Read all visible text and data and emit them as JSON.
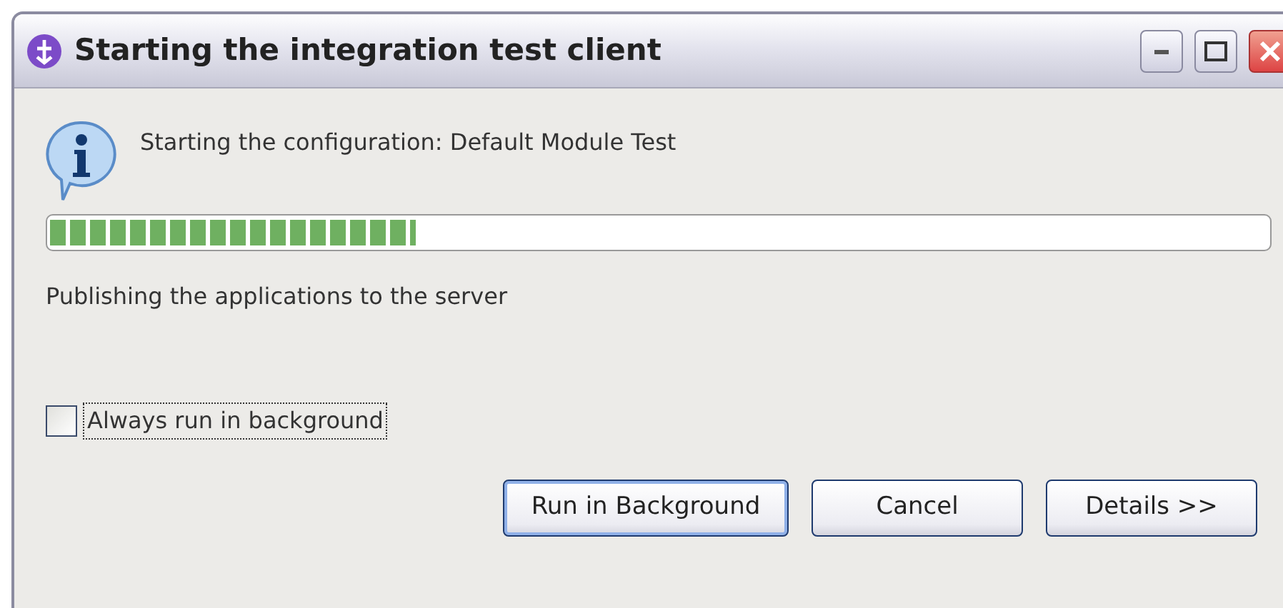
{
  "window": {
    "title": "Starting the integration test client"
  },
  "message": "Starting the configuration: Default Module Test",
  "progress": {
    "level": 0.3
  },
  "status": "Publishing the applications to the server",
  "always_run_in_background": {
    "label": "Always run in background",
    "checked": false
  },
  "buttons": [
    {
      "label": "Run in Background",
      "selected": true
    },
    {
      "label": "Cancel",
      "selected": false
    },
    {
      "label": "Details >>",
      "selected": false
    }
  ]
}
